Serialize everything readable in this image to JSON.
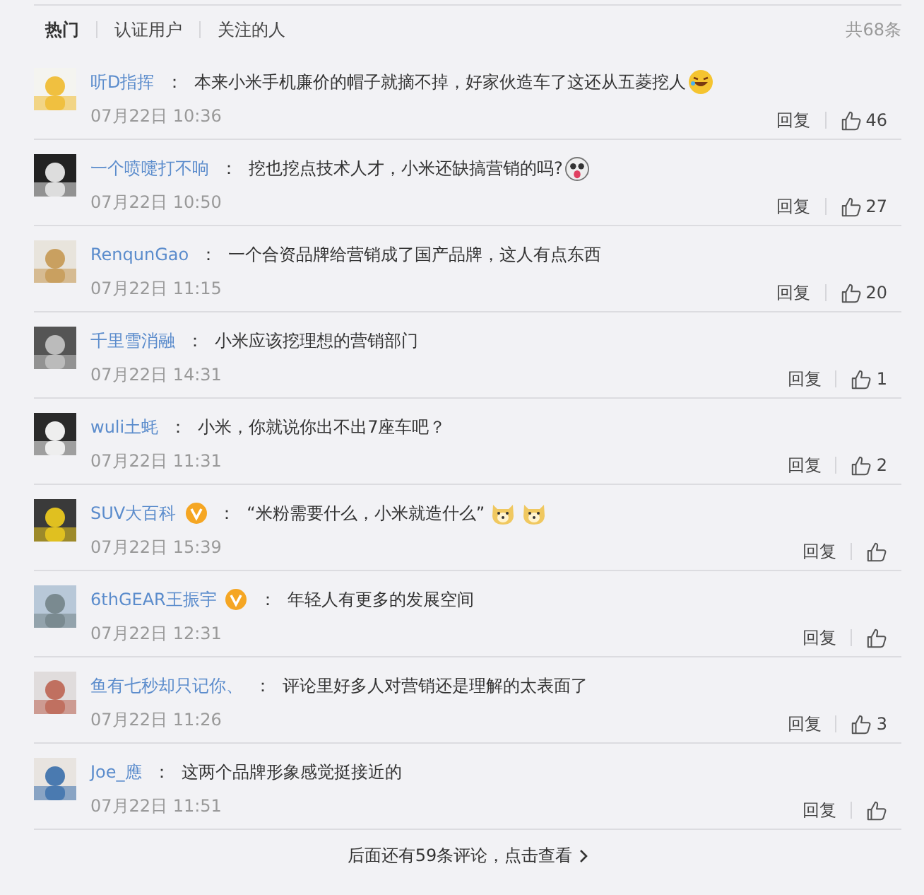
{
  "tabs": [
    {
      "label": "热门",
      "selected": true
    },
    {
      "label": "认证用户",
      "selected": false
    },
    {
      "label": "关注的人",
      "selected": false
    }
  ],
  "total": "共68条",
  "comments": [
    {
      "user": "听D指挥",
      "verified": false,
      "colon": "：",
      "text": "本来小米手机廉价的帽子就摘不掉，好家伙造车了这还从五菱挖人",
      "emojis": [
        {
          "kind": "laugh"
        }
      ],
      "time": "07月22日 10:36",
      "reply": "回复",
      "likes": "46"
    },
    {
      "user": "一个喷嚏打不响",
      "verified": false,
      "colon": "：",
      "text": "挖也挖点技术人才，小米还缺搞营销的吗?",
      "emojis": [
        {
          "kind": "tongue"
        }
      ],
      "time": "07月22日 10:50",
      "reply": "回复",
      "likes": "27"
    },
    {
      "user": "RenqunGao",
      "verified": false,
      "colon": "：",
      "text": "一个合资品牌给营销成了国产品牌，这人有点东西",
      "time": "07月22日 11:15",
      "reply": "回复",
      "likes": "20"
    },
    {
      "user": "千里雪消融",
      "verified": false,
      "colon": "：",
      "text": "小米应该挖理想的营销部门",
      "time": "07月22日 14:31",
      "reply": "回复",
      "likes": "1"
    },
    {
      "user": "wuli土蚝",
      "verified": false,
      "colon": "：",
      "text": "小米，你就说你出不出7座车吧？",
      "time": "07月22日 11:31",
      "reply": "回复",
      "likes": "2"
    },
    {
      "user": "SUV大百科",
      "verified": true,
      "colon": "：",
      "text": "“米粉需要什么，小米就造什么”",
      "emojis": [
        {
          "kind": "doge"
        },
        {
          "kind": "doge"
        }
      ],
      "time": "07月22日 15:39",
      "reply": "回复"
    },
    {
      "user": "6thGEAR王振宇",
      "verified": true,
      "colon": "：",
      "text": "年轻人有更多的发展空间",
      "time": "07月22日 12:31",
      "reply": "回复"
    },
    {
      "user": "鱼有七秒却只记你、",
      "verified": false,
      "colon": "：",
      "text": "评论里好多人对营销还是理解的太表面了",
      "time": "07月22日 11:26",
      "reply": "回复",
      "likes": "3"
    },
    {
      "user": "Joe_應",
      "verified": false,
      "colon": "：",
      "text": "这两个品牌形象感觉挺接近的",
      "time": "07月22日 11:51",
      "reply": "回复"
    }
  ],
  "footer": "后面还有59条评论，点击查看"
}
